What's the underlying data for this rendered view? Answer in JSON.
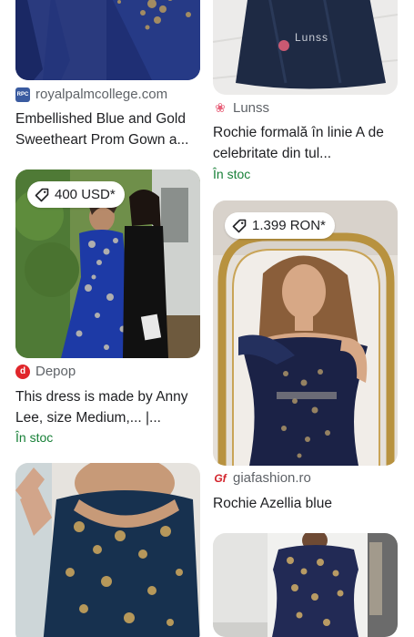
{
  "results": [
    {
      "source": "royalpalmcollege.com",
      "source_icon": "royalpalm-favicon-icon",
      "title_line1": "Embellished Blue and Gold",
      "title_line2": "Sweetheart Prom Gown a...",
      "colors": {
        "dress": "#1f2f74",
        "lace": "#b89a5c"
      }
    },
    {
      "source": "Lunss",
      "source_icon": "lunss-favicon-icon",
      "title_line1": "Rochie formală în linie A de",
      "title_line2": "celebritate din tul...",
      "stock": "În stoc",
      "watermark": "Lunss",
      "colors": {
        "dress": "#1e2a44"
      }
    },
    {
      "source": "Depop",
      "source_icon": "depop-favicon-icon",
      "price": "400 USD*",
      "title_line1": "This dress is made by Anny",
      "title_line2": "Lee, size Medium,... |...",
      "stock": "În stoc",
      "colors": {
        "dress": "#1d3aa6",
        "lace": "#c9c4b0"
      }
    },
    {
      "source": "giafashion.ro",
      "source_icon": "giafashion-favicon-icon",
      "price": "1.399 RON*",
      "title_line1": "Rochie Azellia blue",
      "colors": {
        "dress": "#1b2246",
        "mirror": "#b8923f"
      }
    },
    {
      "source": "",
      "colors": {
        "dress": "#17314f",
        "lace": "#c8a45c"
      }
    },
    {
      "source": "",
      "colors": {
        "dress": "#222a55",
        "lace": "#c9a866"
      }
    }
  ],
  "colors": {
    "stock_green": "#188038",
    "depop_red": "#e0262b",
    "gia_red": "#d3232b",
    "lunss_pink": "#e8617a"
  }
}
